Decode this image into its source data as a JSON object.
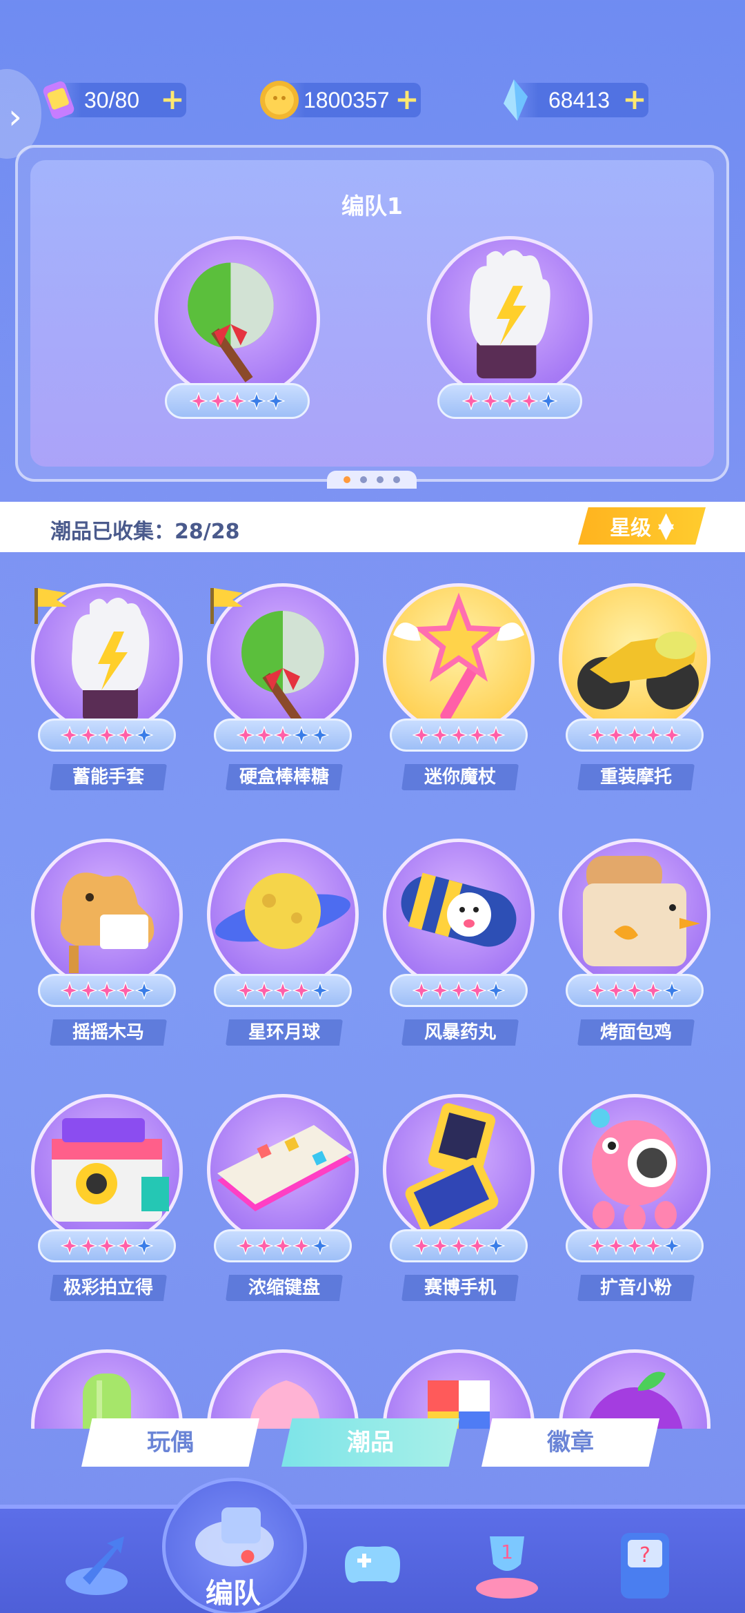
{
  "resources": {
    "energy": "30/80",
    "coins": "1800357",
    "gems": "68413",
    "plus": "+"
  },
  "team": {
    "title": "编队1",
    "slots": [
      {
        "name": "硬盒棒棒糖",
        "stars": 3,
        "max_stars": 5
      },
      {
        "name": "蓄能手套",
        "stars": 4,
        "max_stars": 5
      }
    ],
    "page_dots": 4,
    "active_dot": 0
  },
  "collection": {
    "label": "潮品已收集：28/28",
    "sort_label": "星级"
  },
  "items": [
    {
      "name": "蓄能手套",
      "stars": 4
    },
    {
      "name": "硬盒棒棒糖",
      "stars": 3
    },
    {
      "name": "迷你魔杖",
      "stars": 5
    },
    {
      "name": "重装摩托",
      "stars": 5
    },
    {
      "name": "摇摇木马",
      "stars": 4
    },
    {
      "name": "星环月球",
      "stars": 4
    },
    {
      "name": "风暴药丸",
      "stars": 4
    },
    {
      "name": "烤面包鸡",
      "stars": 4
    },
    {
      "name": "极彩拍立得",
      "stars": 4
    },
    {
      "name": "浓缩键盘",
      "stars": 4
    },
    {
      "name": "赛博手机",
      "stars": 4
    },
    {
      "name": "扩音小粉",
      "stars": 4
    }
  ],
  "tabs": [
    {
      "label": "玩偶",
      "active": false
    },
    {
      "label": "潮品",
      "active": true
    },
    {
      "label": "徽章",
      "active": false
    }
  ],
  "nav": {
    "active_label": "编队"
  },
  "colors": {
    "star_pink": "#ff5fa8",
    "star_blue": "#3a7de8",
    "accent_yellow": "#ffc12a"
  }
}
